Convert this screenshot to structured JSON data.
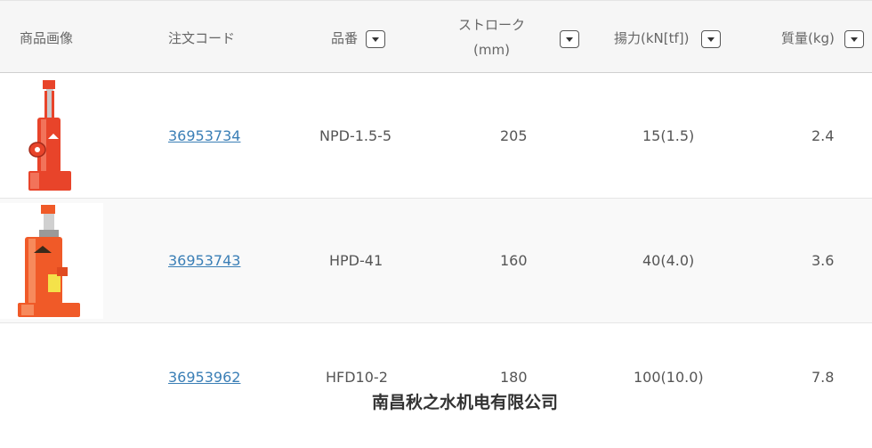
{
  "header": {
    "image_col": "商品画像",
    "order_code_col": "注文コード",
    "part_no_col": "品番",
    "stroke_col_line1": "ストローク",
    "stroke_col_line2": "(mm)",
    "force_col": "揚力(kN[tf])",
    "mass_col": "質量(kg)"
  },
  "rows": [
    {
      "order_code": "36953734",
      "part_no": "NPD-1.5-5",
      "stroke": "205",
      "force": "15(1.5)",
      "mass": "2.4"
    },
    {
      "order_code": "36953743",
      "part_no": "HPD-41",
      "stroke": "160",
      "force": "40(4.0)",
      "mass": "3.6"
    },
    {
      "order_code": "36953962",
      "part_no": "HFD10-2",
      "stroke": "180",
      "force": "100(10.0)",
      "mass": "7.8"
    }
  ],
  "watermark": "南昌秋之水机电有限公司",
  "colors": {
    "link": "#3b7fb6",
    "jack_red": "#e8442a",
    "jack_orange": "#f05a28"
  }
}
